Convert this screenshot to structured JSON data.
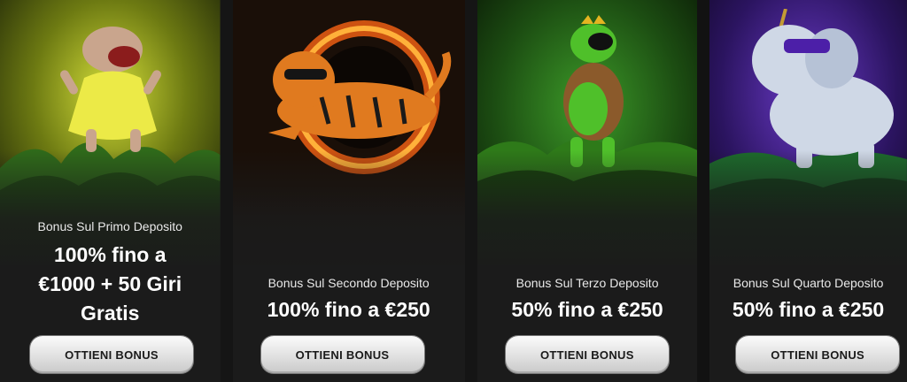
{
  "offers": [
    {
      "subtitle": "Bonus Sul Primo Deposito",
      "headline_lines": [
        "100% fino a",
        "€1000 + 50 Giri",
        "Gratis"
      ],
      "button": "OTTIENI BONUS",
      "mascot": "hippo-mascot-icon",
      "theme": "#b5c21b"
    },
    {
      "subtitle": "Bonus Sul Secondo Deposito",
      "headline_lines": [
        "100% fino a €250"
      ],
      "button": "OTTIENI BONUS",
      "mascot": "tiger-mascot-icon",
      "theme": "#e8661c"
    },
    {
      "subtitle": "Bonus Sul Terzo Deposito",
      "headline_lines": [
        "50% fino a €250"
      ],
      "button": "OTTIENI BONUS",
      "mascot": "turtle-mascot-icon",
      "theme": "#2f7d1d"
    },
    {
      "subtitle": "Bonus Sul Quarto Deposito",
      "headline_lines": [
        "50% fino a €250"
      ],
      "button": "OTTIENI BONUS",
      "mascot": "elephant-mascot-icon",
      "theme": "#4a1f8f"
    }
  ]
}
